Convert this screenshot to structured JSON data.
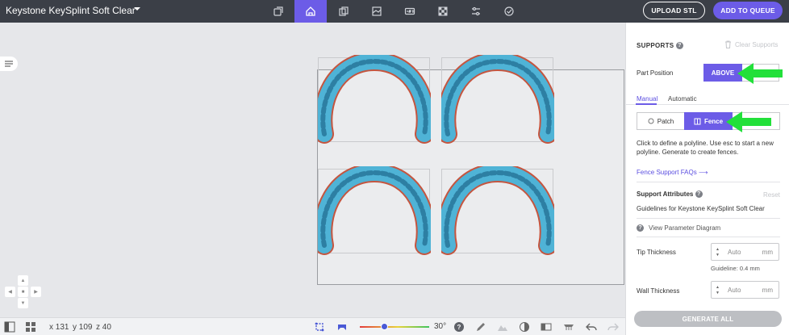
{
  "topbar": {
    "material": "Keystone KeySplint Soft Clear",
    "tools": [
      {
        "icon": "orient-icon"
      },
      {
        "icon": "supports-icon",
        "active": true
      },
      {
        "icon": "layout-icon"
      },
      {
        "icon": "slice-preview-icon"
      },
      {
        "icon": "label-icon"
      },
      {
        "icon": "checker-icon"
      },
      {
        "icon": "settings-icon"
      },
      {
        "icon": "check-icon"
      }
    ],
    "upload_label": "UPLOAD STL",
    "queue_label": "ADD TO QUEUE",
    "accent": "#6c5ce7"
  },
  "bottombar": {
    "x_label": "x 131",
    "y_label": "y 109",
    "z_label": "z 40",
    "angle": "30°"
  },
  "panel": {
    "title": "SUPPORTS",
    "clear_label": "Clear Supports",
    "part_position_label": "Part Position",
    "above_label": "ABOVE",
    "tabs": [
      "Manual",
      "Automatic"
    ],
    "patch_label": "Patch",
    "fence_label": "Fence",
    "description": "Click to define a polyline. Use esc to start a new polyline. Generate to create fences.",
    "faq_label": "Fence Support FAQs",
    "attributes_title": "Support Attributes",
    "reset_label": "Reset",
    "guidelines": "Guidelines for Keystone KeySplint Soft Clear",
    "view_param": "View Parameter Diagram",
    "tip_label": "Tip Thickness",
    "tip_value": "Auto",
    "tip_unit": "mm",
    "tip_guideline": "Guideline: 0.4 mm",
    "wall_label": "Wall Thickness",
    "wall_value": "Auto",
    "wall_unit": "mm",
    "generate_label": "GENERATE ALL"
  }
}
